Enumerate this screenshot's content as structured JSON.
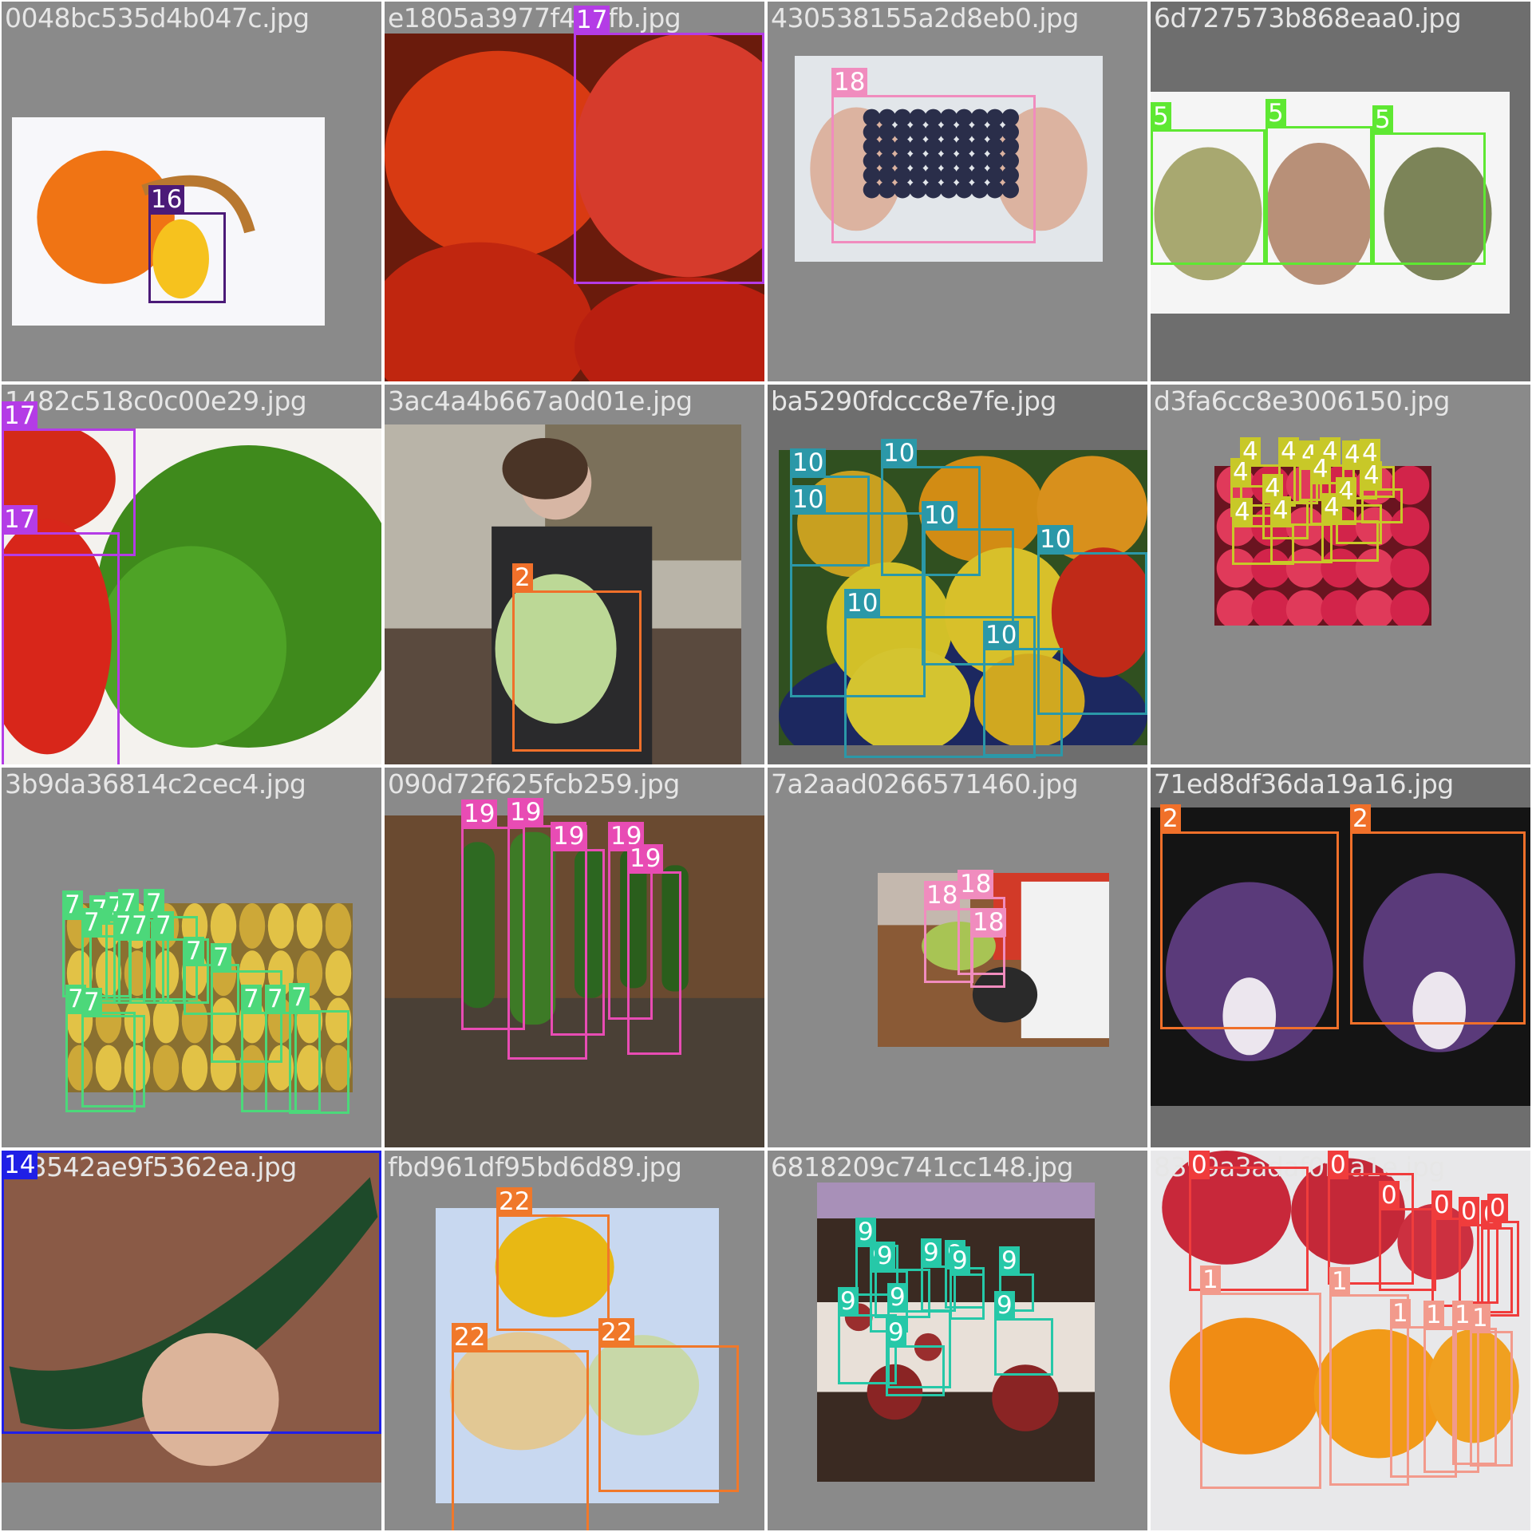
{
  "title": "",
  "class_colors": {
    "0": "#f03c3c",
    "1": "#f29a8c",
    "2": "#f0702a",
    "4": "#c8c828",
    "5": "#5ee832",
    "7": "#4cd87a",
    "9": "#26c8a8",
    "10": "#2b98a8",
    "14": "#1f1fe6",
    "16": "#4b1a78",
    "17": "#b43ce6",
    "18": "#f08cbe",
    "19": "#e84cb4",
    "22": "#f0782a"
  },
  "tiles": [
    {
      "file": "0048bc535d4b047c.jpg",
      "scene": "pumpkin-lemon",
      "labels": [
        "16"
      ]
    },
    {
      "file": "e1805a3977f417fb.jpg",
      "scene": "tomatoes-peppers",
      "labels": [
        "17"
      ]
    },
    {
      "file": "430538155a2d8eb0.jpg",
      "scene": "grapes-hands",
      "labels": [
        "18"
      ]
    },
    {
      "file": "6d727573b868eaa0.jpg",
      "scene": "pears-three",
      "labels": [
        "5",
        "5",
        "5"
      ]
    },
    {
      "file": "1482c518c0c00e29.jpg",
      "scene": "tomato-parsley",
      "labels": [
        "17",
        "17"
      ]
    },
    {
      "file": "3ac4a4b667a0d01e.jpg",
      "scene": "kitchen-cabbage",
      "labels": [
        "2"
      ]
    },
    {
      "file": "ba5290fdccc8e7fe.jpg",
      "scene": "pears-bowl",
      "labels": [
        "10",
        "10",
        "10",
        "10",
        "10",
        "10",
        "10"
      ]
    },
    {
      "file": "d3fa6cc8e3006150.jpg",
      "scene": "red-apples",
      "labels": [
        "4",
        "4",
        "4",
        "4",
        "4",
        "4",
        "4",
        "4",
        "4",
        "4",
        "4",
        "4",
        "4",
        "4"
      ]
    },
    {
      "file": "3b9da36814c2cec4.jpg",
      "scene": "bananas",
      "labels": [
        "7",
        "7",
        "7",
        "7",
        "7",
        "7",
        "7",
        "7",
        "7",
        "7",
        "7",
        "7",
        "7",
        "7",
        "7",
        "7"
      ]
    },
    {
      "file": "090d72f625fcb259.jpg",
      "scene": "zucchini",
      "labels": [
        "19",
        "19",
        "19",
        "19",
        "19"
      ]
    },
    {
      "file": "7a2aad0266571460.jpg",
      "scene": "grapes-table",
      "labels": [
        "18",
        "18",
        "18"
      ]
    },
    {
      "file": "71ed8df36da19a16.jpg",
      "scene": "red-cabbage",
      "labels": [
        "2",
        "2"
      ]
    },
    {
      "file": "1f3542ae9f5362ea.jpg",
      "scene": "cucumber",
      "labels": [
        "14"
      ]
    },
    {
      "file": "fbd961df95bd6d89.jpg",
      "scene": "melons",
      "labels": [
        "22",
        "22",
        "22"
      ]
    },
    {
      "file": "6818209c741cc148.jpg",
      "scene": "strawberry-party",
      "labels": [
        "9",
        "9",
        "9",
        "9",
        "9",
        "9",
        "9",
        "9",
        "9",
        "9",
        "9"
      ]
    },
    {
      "file": "8399a3adaf0f9a1e.jpg",
      "scene": "apples-oranges-fridge",
      "labels": [
        "0",
        "0",
        "0",
        "0",
        "0",
        "0",
        "0",
        "1",
        "1",
        "1",
        "1",
        "1",
        "1"
      ]
    }
  ]
}
